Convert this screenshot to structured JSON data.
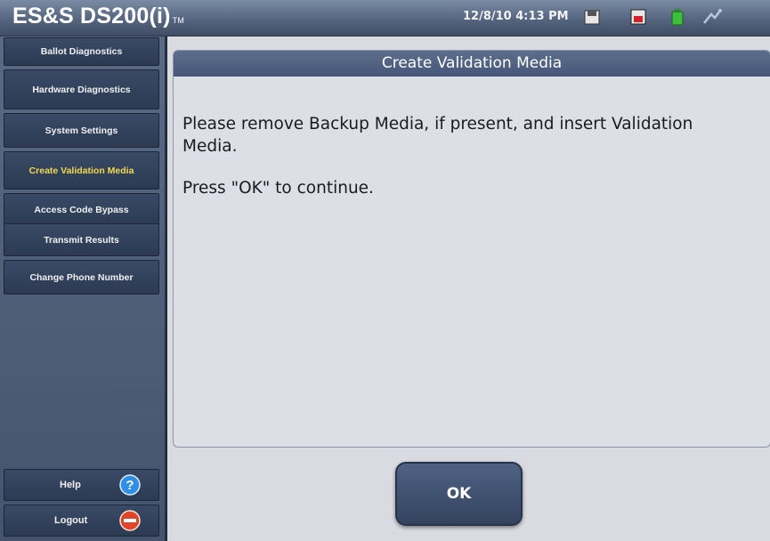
{
  "titlebar": {
    "app_name": "ES&S DS200(i)",
    "app_tm": "TM",
    "datetime": "12/8/10 4:13 PM",
    "status_icons": [
      "disk-icon",
      "memory-card-icon",
      "battery-icon",
      "network-icon"
    ]
  },
  "sidebar": {
    "items": [
      {
        "label": "Ballot Diagnostics",
        "active": false
      },
      {
        "label": "Hardware Diagnostics",
        "active": false
      },
      {
        "label": "System Settings",
        "active": false
      },
      {
        "label": "Create Validation Media",
        "active": true
      },
      {
        "label": "Access Code Bypass",
        "active": false
      },
      {
        "label": "Transmit Results",
        "active": false
      },
      {
        "label": "Change Phone Number",
        "active": false
      }
    ],
    "help_label": "Help",
    "logout_label": "Logout"
  },
  "panel": {
    "title": "Create Validation Media",
    "message_line1": "Please remove Backup Media, if present, and insert Validation Media.",
    "message_line2": "Press \"OK\" to continue."
  },
  "ok_label": "OK",
  "colors": {
    "active_nav_text": "#f2d84c",
    "nav_text": "#f0f0f0",
    "header_bg": "#4e5f80",
    "help_icon": "#2f8ee8",
    "logout_icon": "#e0452a"
  }
}
